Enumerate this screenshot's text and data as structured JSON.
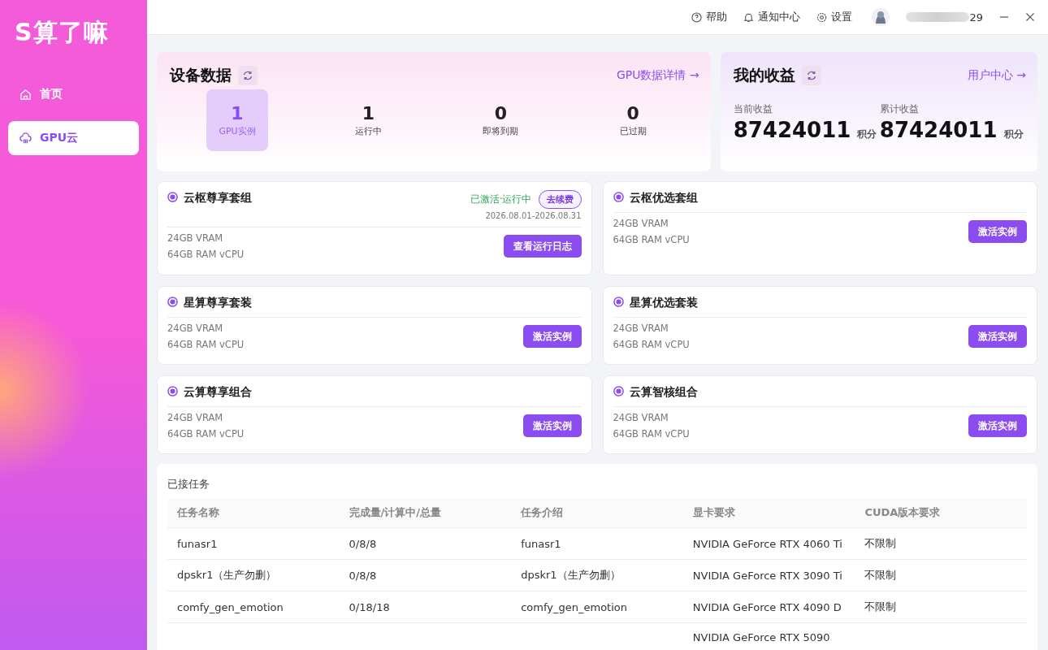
{
  "app": {
    "logo": "S算了嘛"
  },
  "sidebar": {
    "items": [
      {
        "label": "首页",
        "selected": false
      },
      {
        "label": "GPU云",
        "selected": true
      }
    ]
  },
  "topbar": {
    "links": [
      "帮助",
      "通知中心",
      "设置"
    ],
    "user_suffix": "29"
  },
  "device_data": {
    "title": "设备数据",
    "link": "GPU数据详情 →",
    "stats": [
      {
        "value": "1",
        "label": "GPU实例",
        "selected": true
      },
      {
        "value": "1",
        "label": "运行中",
        "selected": false
      },
      {
        "value": "0",
        "label": "即将到期",
        "selected": false
      },
      {
        "value": "0",
        "label": "已过期",
        "selected": false
      }
    ]
  },
  "earnings": {
    "title": "我的收益",
    "link": "用户中心 →",
    "items": [
      {
        "label": "当前收益",
        "value": "87424011",
        "unit": "积分"
      },
      {
        "label": "累计收益",
        "value": "87424011",
        "unit": "积分"
      }
    ]
  },
  "packages": [
    {
      "name": "云枢尊享套组",
      "active": true,
      "status": "已激活·运行中",
      "renew": "去续费",
      "period": "2026.08.01-2026.08.31",
      "specs": [
        "24GB VRAM",
        "64GB RAM vCPU"
      ],
      "action": "查看运行日志"
    },
    {
      "name": "云枢优选套组",
      "active": false,
      "specs": [
        "24GB VRAM",
        "64GB RAM vCPU"
      ],
      "action": "激活实例"
    },
    {
      "name": "星算尊享套装",
      "active": false,
      "specs": [
        "24GB VRAM",
        "64GB RAM vCPU"
      ],
      "action": "激活实例"
    },
    {
      "name": "星算优选套装",
      "active": false,
      "specs": [
        "24GB VRAM",
        "64GB RAM vCPU"
      ],
      "action": "激活实例"
    },
    {
      "name": "云算尊享组合",
      "active": false,
      "specs": [
        "24GB VRAM",
        "64GB RAM vCPU"
      ],
      "action": "激活实例"
    },
    {
      "name": "云算智核组合",
      "active": false,
      "specs": [
        "24GB VRAM",
        "64GB RAM vCPU"
      ],
      "action": "激活实例"
    }
  ],
  "tasks": {
    "title": "已接任务",
    "columns": [
      "任务名称",
      "完成量/计算中/总量",
      "任务介绍",
      "显卡要求",
      "CUDA版本要求"
    ],
    "rows": [
      [
        "funasr1",
        "0/8/8",
        "funasr1",
        "NVIDIA GeForce RTX 4060 Ti",
        "不限制"
      ],
      [
        "dpskr1（生产勿删）",
        "0/8/8",
        "dpskr1（生产勿删）",
        "NVIDIA GeForce RTX 3090 Ti",
        "不限制"
      ],
      [
        "comfy_gen_emotion",
        "0/18/18",
        "comfy_gen_emotion",
        "NVIDIA GeForce RTX 4090 D",
        "不限制"
      ],
      [
        "",
        "",
        "",
        "NVIDIA GeForce RTX 5090",
        ""
      ]
    ]
  }
}
